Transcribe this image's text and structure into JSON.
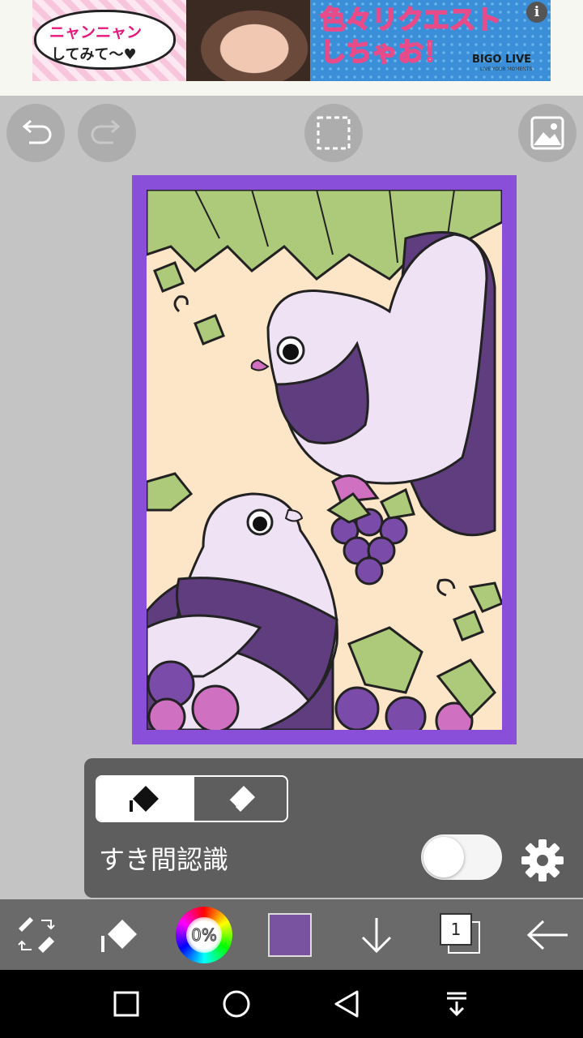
{
  "ad": {
    "bubble_line1": "ニャンニャン",
    "bubble_line2": "してみて〜♥",
    "title": "色々リクエスト\nしちゃお！",
    "brand": "BIGO LIVE",
    "brand_sub": "LIVE YOUR MOMENTS",
    "info_glyph": "i"
  },
  "top_buttons": {
    "undo_icon": "undo-arrow-icon",
    "redo_icon": "redo-arrow-icon",
    "select_icon": "selection-rect-icon",
    "image_icon": "image-icon"
  },
  "canvas": {
    "frame_color": "#8a4fd8",
    "background_color": "#fde5c8"
  },
  "fill_panel": {
    "mode_fill_icon": "bucket-fill-icon",
    "mode_erase_icon": "eraser-icon",
    "selected_mode": "fill",
    "gap_detection_label": "すき間認識",
    "gap_detection_on": false,
    "settings_icon": "gear-icon"
  },
  "toolbar": {
    "tool_switch_icon": "pen-eraser-switch-icon",
    "fill_tool_icon": "bucket-fill-icon",
    "opacity_label": "0%",
    "current_color": "#7a53a0",
    "download_icon": "down-arrow-icon",
    "layer_count": "1",
    "back_icon": "back-arrow-icon"
  },
  "navbar": {
    "recents_icon": "square-icon",
    "home_icon": "circle-icon",
    "back_icon": "triangle-back-icon",
    "notif_icon": "pull-down-icon"
  }
}
